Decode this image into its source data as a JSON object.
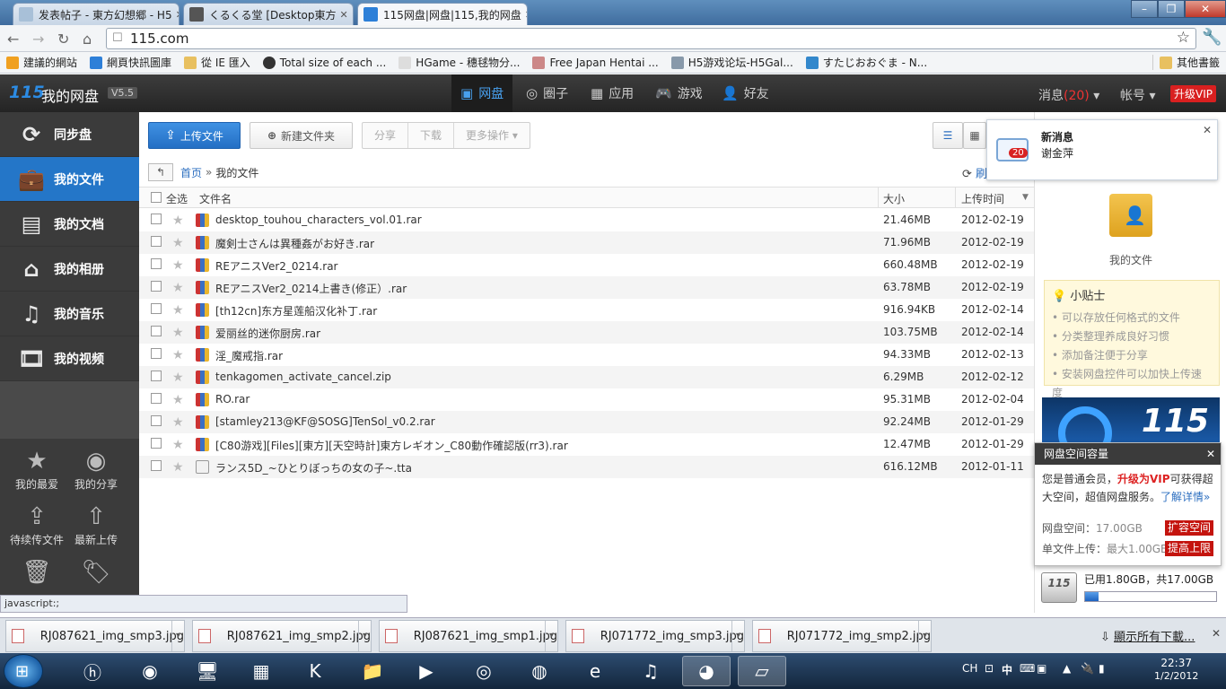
{
  "browser": {
    "tabs": [
      {
        "title": "发表帖子 - 東方幻想郷 - H5"
      },
      {
        "title": "くるくる堂 [Desktop東方"
      },
      {
        "title": "115网盘|网盘|115,我的网盘"
      }
    ],
    "address": "115.com",
    "bookmarks": [
      {
        "label": "建議的網站"
      },
      {
        "label": "網頁快訊圖庫"
      },
      {
        "label": "從 IE 匯入"
      },
      {
        "label": "Total size of each ..."
      },
      {
        "label": "HGame - 穗毬物分..."
      },
      {
        "label": "Free Japan Hentai ..."
      },
      {
        "label": "H5游戏论坛-H5Gal..."
      },
      {
        "label": "すたじおおぐま - N..."
      }
    ],
    "other_bookmarks": "其他書籤",
    "status_text": "javascript:;"
  },
  "app": {
    "logo": "115",
    "logo_text": "我的网盘",
    "version": "V5.5",
    "nav": [
      {
        "label": "网盘"
      },
      {
        "label": "圈子"
      },
      {
        "label": "应用"
      },
      {
        "label": "游戏"
      },
      {
        "label": "好友"
      }
    ],
    "messages_label": "消息",
    "messages_count": "(20)",
    "account_label": "帐号",
    "vip_label": "升级VIP"
  },
  "sidebar": {
    "items": [
      {
        "label": "同步盘"
      },
      {
        "label": "我的文件"
      },
      {
        "label": "我的文档"
      },
      {
        "label": "我的相册"
      },
      {
        "label": "我的音乐"
      },
      {
        "label": "我的视频"
      }
    ],
    "grid": [
      {
        "label": "我的最爱"
      },
      {
        "label": "我的分享"
      },
      {
        "label": "待续传文件"
      },
      {
        "label": "最新上传"
      }
    ]
  },
  "toolbar": {
    "upload": "上传文件",
    "new_folder": "新建文件夹",
    "share": "分享",
    "download": "下载",
    "more": "更多操作"
  },
  "breadcrumb": {
    "home": "首页",
    "sep": "»",
    "current": "我的文件",
    "refresh": "刷"
  },
  "table": {
    "select_all": "全选",
    "col_name": "文件名",
    "col_size": "大小",
    "col_time": "上传时间",
    "rows": [
      {
        "name": "desktop_touhou_characters_vol.01.rar",
        "size": "21.46MB",
        "time": "2012-02-19",
        "type": "rar"
      },
      {
        "name": "魔剣士さんは異種姦がお好き.rar",
        "size": "71.96MB",
        "time": "2012-02-19",
        "type": "rar"
      },
      {
        "name": "REアニスVer2_0214.rar",
        "size": "660.48MB",
        "time": "2012-02-19",
        "type": "rar"
      },
      {
        "name": "REアニスVer2_0214上書き(修正）.rar",
        "size": "63.78MB",
        "time": "2012-02-19",
        "type": "rar"
      },
      {
        "name": "[th12cn]东方星莲船汉化补丁.rar",
        "size": "916.94KB",
        "time": "2012-02-14",
        "type": "rar"
      },
      {
        "name": "爱丽丝的迷你厨房.rar",
        "size": "103.75MB",
        "time": "2012-02-14",
        "type": "rar"
      },
      {
        "name": "淫_魔戒指.rar",
        "size": "94.33MB",
        "time": "2012-02-13",
        "type": "rar"
      },
      {
        "name": "tenkagomen_activate_cancel.zip",
        "size": "6.29MB",
        "time": "2012-02-12",
        "type": "rar"
      },
      {
        "name": "RO.rar",
        "size": "95.31MB",
        "time": "2012-02-04",
        "type": "rar"
      },
      {
        "name": "[stamley213@KF@SOSG]TenSol_v0.2.rar",
        "size": "92.24MB",
        "time": "2012-01-29",
        "type": "rar"
      },
      {
        "name": "[C80游戏][Files][東方][天空時計]東方レギオン_C80動作確認版(rr3).rar",
        "size": "12.47MB",
        "time": "2012-01-29",
        "type": "rar"
      },
      {
        "name": "ランス5D_~ひとりぼっちの女の子~.tta",
        "size": "616.12MB",
        "time": "2012-01-11",
        "type": "tta"
      }
    ]
  },
  "right": {
    "folder_label": "我的文件",
    "tips_title": "小贴士",
    "tips": [
      "可以存放任何格式的文件",
      "分类整理养成良好习惯",
      "添加备注便于分享",
      "安装网盘控件可以加快上传速度"
    ],
    "banner_text": "115"
  },
  "notification": {
    "badge": "20",
    "title": "新消息",
    "sender": "谢金萍"
  },
  "storage": {
    "title": "网盘空间容量",
    "desc_a": "您是普通会员，",
    "desc_b": "升级为VIP",
    "desc_c": "可获得超大空间，超值网盘服务。",
    "more": "了解详情»",
    "space_label": "网盘空间：",
    "space_value": "17.00GB",
    "expand": "扩容空间",
    "single_label": "单文件上传：",
    "single_value": "最大1.00GB",
    "raise": "提高上限",
    "used": "已用1.80GB，共17.00GB",
    "used_fraction": 0.106
  },
  "downloads": {
    "items": [
      {
        "name": "RJ087621_img_smp3.jpg"
      },
      {
        "name": "RJ087621_img_smp2.jpg"
      },
      {
        "name": "RJ087621_img_smp1.jpg"
      },
      {
        "name": "RJ071772_img_smp3.jpg"
      },
      {
        "name": "RJ071772_img_smp2.jpg"
      }
    ],
    "show_all": "顯示所有下載..."
  },
  "taskbar": {
    "lang": "CH",
    "time": "22:37",
    "date": "1/2/2012",
    "ime": "中"
  },
  "colors": {
    "accent": "#2476c8",
    "vip": "#d92020",
    "nav_active": "#48a0ee"
  }
}
